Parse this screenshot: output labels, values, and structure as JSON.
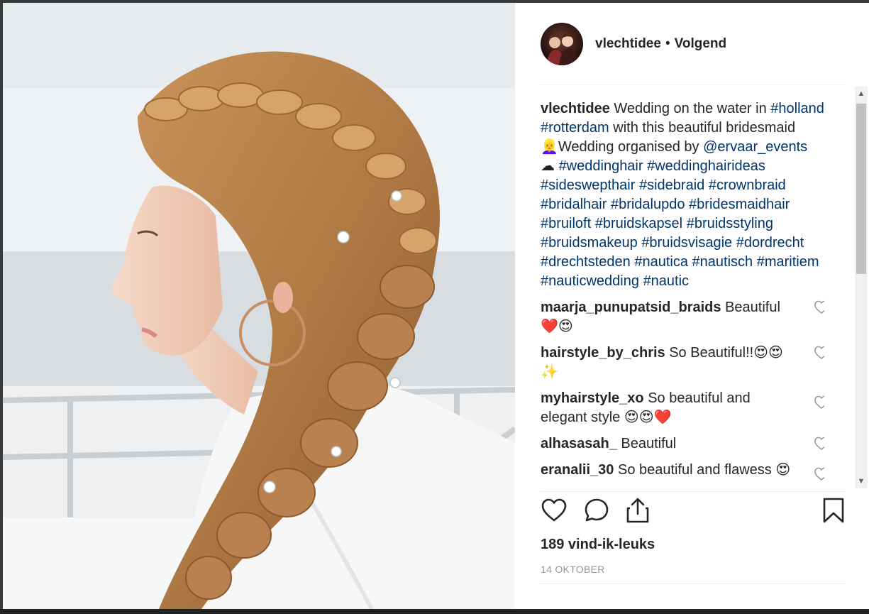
{
  "post": {
    "username": "vlechtidee",
    "separator": "•",
    "follow_status": "Volgend",
    "caption": {
      "user": "vlechtidee",
      "segments": [
        {
          "t": "text",
          "v": " Wedding on the water in "
        },
        {
          "t": "tag",
          "v": "#holland"
        },
        {
          "t": "text",
          "v": " "
        },
        {
          "t": "tag",
          "v": "#rotterdam"
        },
        {
          "t": "text",
          "v": " with this beautiful bridesmaid 👱‍♀️Wedding organised by "
        },
        {
          "t": "tag",
          "v": "@ervaar_events"
        },
        {
          "t": "text",
          "v": " ☁ "
        },
        {
          "t": "tag",
          "v": "#weddinghair"
        },
        {
          "t": "text",
          "v": " "
        },
        {
          "t": "tag",
          "v": "#weddinghairideas"
        },
        {
          "t": "text",
          "v": " "
        },
        {
          "t": "tag",
          "v": "#sideswepthair"
        },
        {
          "t": "text",
          "v": " "
        },
        {
          "t": "tag",
          "v": "#sidebraid"
        },
        {
          "t": "text",
          "v": " "
        },
        {
          "t": "tag",
          "v": "#crownbraid"
        },
        {
          "t": "text",
          "v": " "
        },
        {
          "t": "tag",
          "v": "#bridalhair"
        },
        {
          "t": "text",
          "v": " "
        },
        {
          "t": "tag",
          "v": "#bridalupdo"
        },
        {
          "t": "text",
          "v": " "
        },
        {
          "t": "tag",
          "v": "#bridesmaidhair"
        },
        {
          "t": "text",
          "v": " "
        },
        {
          "t": "tag",
          "v": "#bruiloft"
        },
        {
          "t": "text",
          "v": " "
        },
        {
          "t": "tag",
          "v": "#bruidskapsel"
        },
        {
          "t": "text",
          "v": " "
        },
        {
          "t": "tag",
          "v": "#bruidsstyling"
        },
        {
          "t": "text",
          "v": " "
        },
        {
          "t": "tag",
          "v": "#bruidsmakeup"
        },
        {
          "t": "text",
          "v": " "
        },
        {
          "t": "tag",
          "v": "#bruidsvisagie"
        },
        {
          "t": "text",
          "v": " "
        },
        {
          "t": "tag",
          "v": "#dordrecht"
        },
        {
          "t": "text",
          "v": " "
        },
        {
          "t": "tag",
          "v": "#drechtsteden"
        },
        {
          "t": "text",
          "v": " "
        },
        {
          "t": "tag",
          "v": "#nautica"
        },
        {
          "t": "text",
          "v": " "
        },
        {
          "t": "tag",
          "v": "#nautisch"
        },
        {
          "t": "text",
          "v": " "
        },
        {
          "t": "tag",
          "v": "#maritiem"
        },
        {
          "t": "text",
          "v": " "
        },
        {
          "t": "tag",
          "v": "#nauticwedding"
        },
        {
          "t": "text",
          "v": " "
        },
        {
          "t": "tag",
          "v": "#nautic"
        }
      ]
    },
    "comments": [
      {
        "user": "maarja_punupatsid_braids",
        "text": " Beautiful ❤️😍"
      },
      {
        "user": "hairstyle_by_chris",
        "text": " So Beautiful!!😍😍✨"
      },
      {
        "user": "myhairstyle_xo",
        "text": " So beautiful and elegant style 😍😍❤️"
      },
      {
        "user": "alhasasah_",
        "text": " Beautiful"
      },
      {
        "user": "eranalii_30",
        "text": " So beautiful and flawess 😍"
      }
    ],
    "likes_text": "189 vind-ik-leuks",
    "date_text": "14 OKTOBER"
  },
  "icons": {
    "like": "heart-outline-icon",
    "comment": "speech-bubble-icon",
    "share": "share-upload-icon",
    "save": "bookmark-icon",
    "comment_like": "small-heart-icon",
    "scroll_up": "▲",
    "scroll_down": "▼"
  },
  "colors": {
    "link": "#003569",
    "text": "#262626",
    "muted": "#999999",
    "divider": "#efefef"
  }
}
